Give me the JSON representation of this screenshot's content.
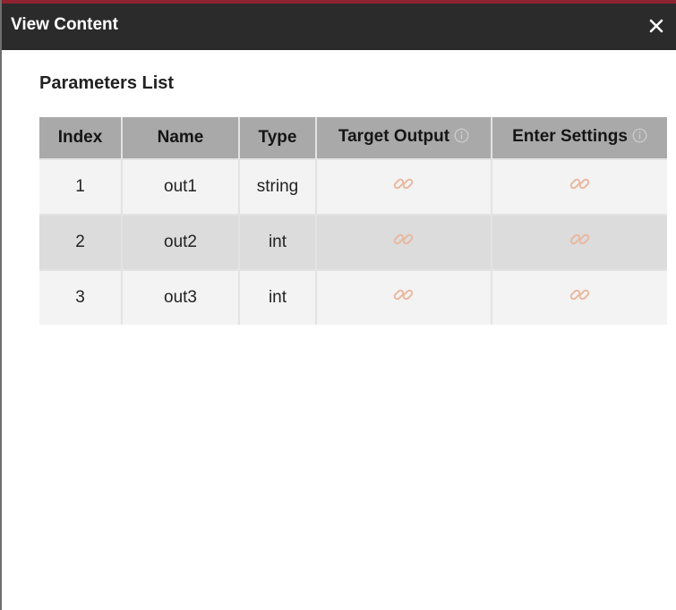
{
  "window": {
    "title": "View Content",
    "close_icon": "close-icon"
  },
  "section": {
    "title": "Parameters List"
  },
  "table": {
    "columns": [
      "Index",
      "Name",
      "Type",
      "Target Output",
      "Enter Settings"
    ],
    "rows": [
      {
        "index": "1",
        "name": "out1",
        "type": "string",
        "target_output": "link-icon",
        "enter_settings": "link-icon"
      },
      {
        "index": "2",
        "name": "out2",
        "type": "int",
        "target_output": "link-icon",
        "enter_settings": "link-icon"
      },
      {
        "index": "3",
        "name": "out3",
        "type": "int",
        "target_output": "link-icon",
        "enter_settings": "link-icon"
      }
    ]
  },
  "colors": {
    "titlebar": "#2b2b2b",
    "titlebar_accent": "#8f2330",
    "header_bg": "#a9a9a9",
    "row_light": "#f3f3f3",
    "row_dark": "#dcdcdc",
    "link_icon": "#e8b9a0"
  }
}
